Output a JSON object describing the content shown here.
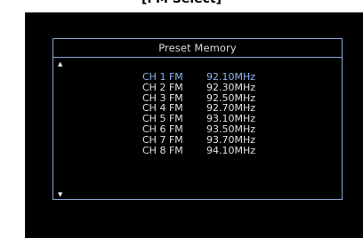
{
  "caption": "[FM Select]",
  "title": "Preset Memory",
  "icons": {
    "scroll_up": "triangle-up-icon",
    "scroll_down": "triangle-down-icon"
  },
  "colors": {
    "border": "#8aa8d6",
    "selected": "#8fb4f0",
    "text": "#e0e0e0",
    "background": "#000000"
  },
  "presets": [
    {
      "channel": "CH 1 FM",
      "frequency": "92.10MHz",
      "selected": true
    },
    {
      "channel": "CH 2 FM",
      "frequency": "92.30MHz"
    },
    {
      "channel": "CH 3 FM",
      "frequency": "92.50MHz"
    },
    {
      "channel": "CH 4 FM",
      "frequency": "92.70MHz"
    },
    {
      "channel": "CH 5 FM",
      "frequency": "93.10MHz"
    },
    {
      "channel": "CH 6 FM",
      "frequency": "93.50MHz"
    },
    {
      "channel": "CH 7 FM",
      "frequency": "93.70MHz"
    },
    {
      "channel": "CH 8 FM",
      "frequency": "94.10MHz"
    }
  ]
}
